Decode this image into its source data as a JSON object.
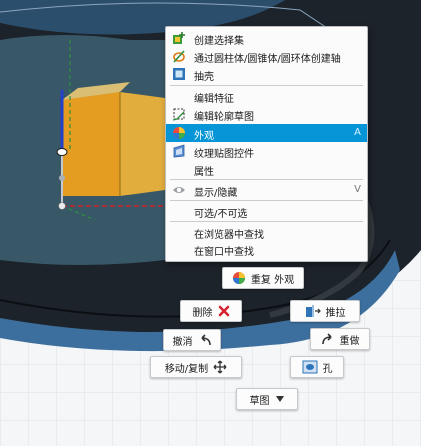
{
  "context_menu": {
    "items": [
      {
        "label": "创建选择集",
        "icon": "create-selection-set-icon"
      },
      {
        "label": "通过圆柱体/圆锥体/圆环体创建轴",
        "icon": "axis-through-cylinder-icon"
      },
      {
        "label": "抽壳",
        "icon": "shell-icon"
      },
      {
        "label": "编辑特征",
        "icon": ""
      },
      {
        "label": "编辑轮廓草图",
        "icon": "edit-profile-sketch-icon"
      },
      {
        "label": "外观",
        "icon": "appearance-icon",
        "shortcut": "A",
        "highlighted": true
      },
      {
        "label": "纹理贴图控件",
        "icon": "texture-map-icon"
      },
      {
        "label": "属性",
        "icon": ""
      },
      {
        "label": "显示/隐藏",
        "icon": "eye-icon",
        "shortcut": "V"
      },
      {
        "label": "可选/不可选",
        "icon": ""
      },
      {
        "label": "在浏览器中查找",
        "icon": ""
      },
      {
        "label": "在窗口中查找",
        "icon": ""
      }
    ]
  },
  "marking_menu": {
    "repeat_label": "重复 外观",
    "delete_label": "删除",
    "press_pull_label": "推拉",
    "undo_label": "撤消",
    "redo_label": "重做",
    "move_copy_label": "移动/复制",
    "hole_label": "孔",
    "sketch_label": "草图"
  },
  "colors": {
    "accent": "#0696d7",
    "body_blue": "#3d6f9e",
    "face_yellow": "#f0b43a",
    "delete_red": "#d9232e",
    "axis_green": "#2f8f3f",
    "axis_red": "#d02020",
    "axis_blue": "#2340c8"
  }
}
